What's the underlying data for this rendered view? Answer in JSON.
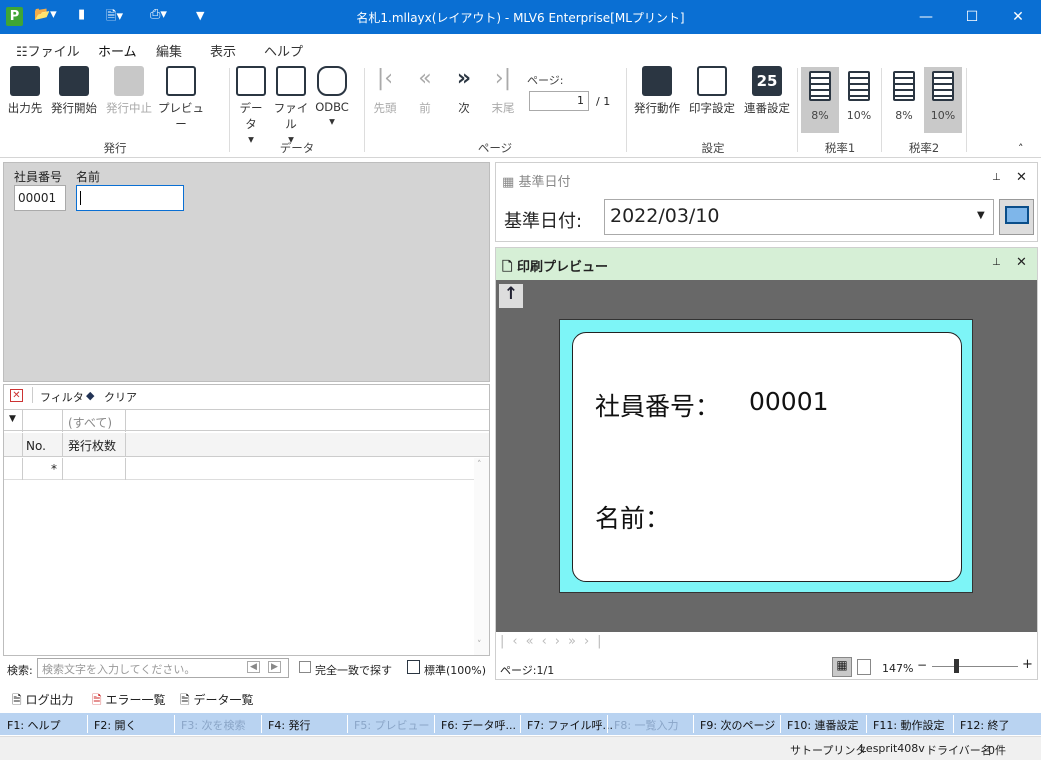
{
  "window": {
    "title": "名札1.mllayx(レイアウト) - MLV6 Enterprise[MLプリント]",
    "app_icon_letter": "P"
  },
  "tabs": [
    {
      "label": "ファイル"
    },
    {
      "label": "ホーム"
    },
    {
      "label": "編集"
    },
    {
      "label": "表示"
    },
    {
      "label": "ヘルプ"
    }
  ],
  "ribbon": {
    "issue": {
      "output": "出力先",
      "start": "発行開始",
      "stop": "発行中止",
      "preview": "プレビュー",
      "group": "発行"
    },
    "data": {
      "data": "データ",
      "file": "ファイル",
      "odbc": "ODBC",
      "group": "データ"
    },
    "page": {
      "first": "先頭",
      "prev": "前",
      "next": "次",
      "last": "末尾",
      "page_label": "ページ:",
      "page_value": "1",
      "page_total": "/ 1",
      "group": "ページ"
    },
    "settings": {
      "action": "発行動作",
      "print": "印字設定",
      "serial": "連番設定",
      "serial_icon_text": "25",
      "group": "設定"
    },
    "tax1": {
      "a": "8%",
      "b": "10%",
      "group": "税率1"
    },
    "tax2": {
      "a": "8%",
      "b": "10%",
      "group": "税率2"
    }
  },
  "form": {
    "emp_label": "社員番号",
    "emp_value": "00001",
    "name_label": "名前",
    "name_value": ""
  },
  "grid": {
    "toolbar": {
      "filter": "フィルタ",
      "clear": "クリア"
    },
    "filter_placeholder": "(すべて)",
    "col_no": "No.",
    "col_count": "発行枚数",
    "new_row_marker": "*"
  },
  "search": {
    "label": "検索:",
    "placeholder": "検索文字を入力してください。",
    "exact": "完全一致で探す",
    "standard": "標準(100%)"
  },
  "date_panel": {
    "title": "基準日付",
    "label": "基準日付:",
    "value": "2022/03/10"
  },
  "preview_panel": {
    "title": "印刷プレビュー",
    "page_info": "ページ:1/1",
    "zoom": "147%"
  },
  "card": {
    "emp_text": "社員番号：",
    "emp_value": "00001",
    "name_text": "名前："
  },
  "bottom_tabs": [
    {
      "label": "ログ出力"
    },
    {
      "label": "エラー一覧"
    },
    {
      "label": "データ一覧"
    }
  ],
  "fkeys": [
    {
      "label": "F1: ヘルプ",
      "enabled": true
    },
    {
      "label": "F2: 開く",
      "enabled": true
    },
    {
      "label": "F3: 次を検索",
      "enabled": false
    },
    {
      "label": "F4: 発行",
      "enabled": true
    },
    {
      "label": "F5: プレビュー",
      "enabled": false
    },
    {
      "label": "F6: データ呼...",
      "enabled": true
    },
    {
      "label": "F7: ファイル呼...",
      "enabled": true
    },
    {
      "label": "F8: 一覧入力",
      "enabled": false
    },
    {
      "label": "F9: 次のページ",
      "enabled": true
    },
    {
      "label": "F10: 連番設定",
      "enabled": true
    },
    {
      "label": "F11: 動作設定",
      "enabled": true
    },
    {
      "label": "F12: 終了",
      "enabled": true
    }
  ],
  "status": {
    "printer": "サトープリンタ",
    "model": "Lesprit408v",
    "driver": "ドライバー名",
    "count": "0件"
  },
  "colors": {
    "titlebar": "#0a6fd3",
    "fkeybar": "#b9d3f1",
    "card_bg": "#7df5f7",
    "preview_bg": "#686868",
    "preview_header": "#d6efd6"
  }
}
